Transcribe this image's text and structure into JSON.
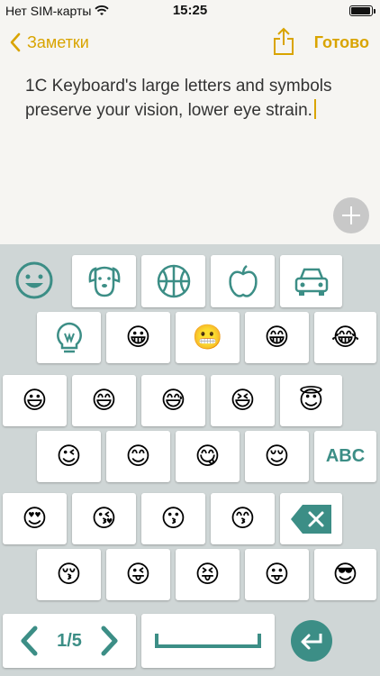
{
  "status": {
    "carrier": "Нет SIM-карты",
    "time": "15:25"
  },
  "nav": {
    "back_label": "Заметки",
    "done_label": "Готово"
  },
  "note": {
    "text": "1C Keyboard's large letters and symbols preserve your vision, lower eye strain."
  },
  "keyboard": {
    "categories": [
      "smiley-face-icon",
      "dog-icon",
      "basketball-icon",
      "apple-icon",
      "car-icon"
    ],
    "rows": [
      [
        "💡",
        "😀",
        "😬",
        "😁",
        "😂"
      ],
      [
        "😃",
        "😄",
        "😅",
        "😆",
        "😇"
      ],
      [
        "😉",
        "😊",
        "😋",
        "😌",
        "ABC"
      ],
      [
        "😍",
        "😘",
        "😗",
        "😙",
        "⌫"
      ],
      [
        "😚",
        "😜",
        "😝",
        "😛",
        "😎"
      ]
    ],
    "page_label": "1/5",
    "abc_label": "ABC"
  },
  "colors": {
    "accent": "#d9a400",
    "keyboard_accent": "#3c8e86",
    "keyboard_bg": "#cfd6d6"
  }
}
